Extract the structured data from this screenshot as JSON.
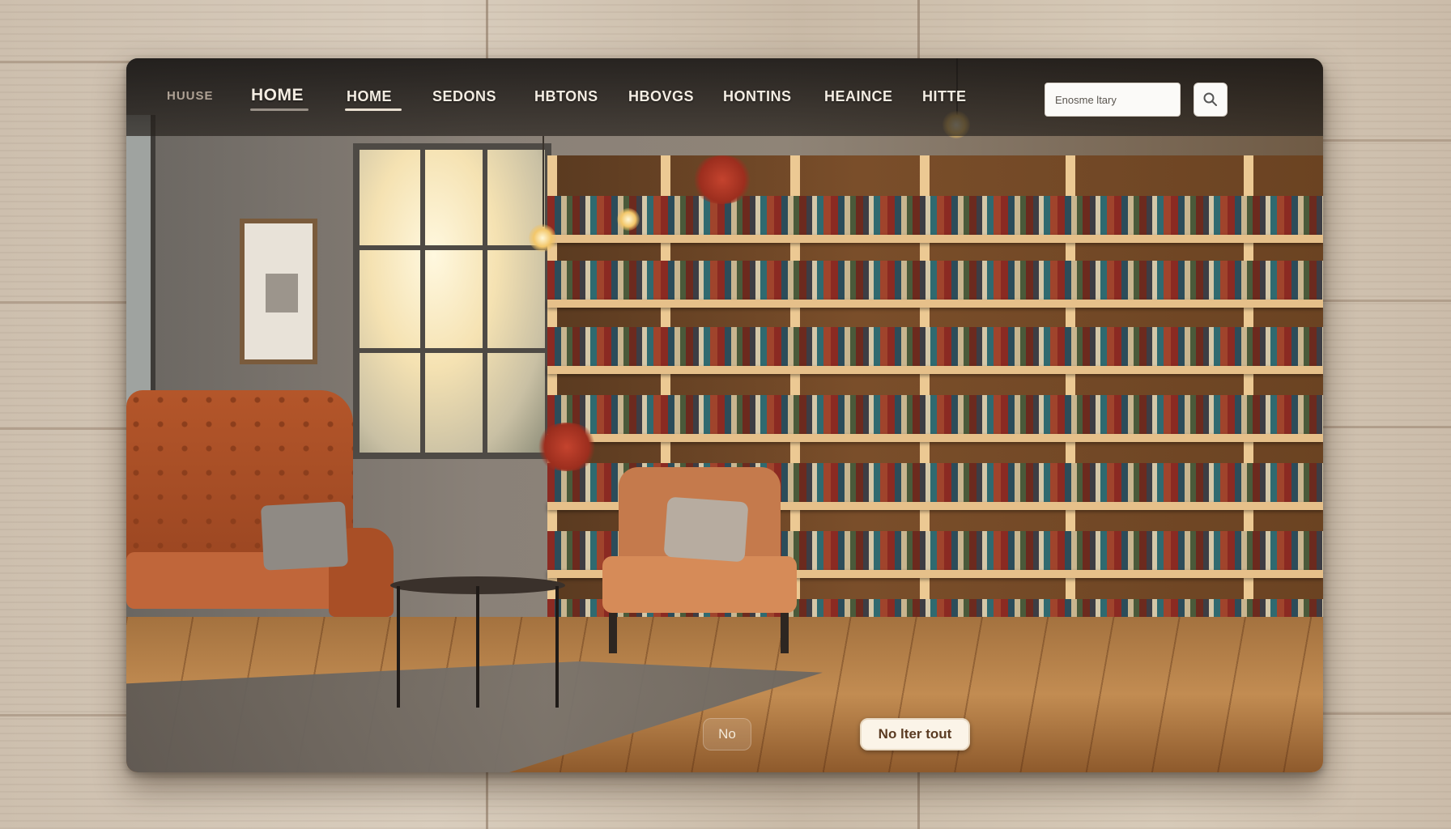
{
  "nav": {
    "brand": "HUUSE",
    "items": [
      {
        "label": "HOME",
        "active": false
      },
      {
        "label": "HOME",
        "active": true
      },
      {
        "label": "SEDONS",
        "active": false
      },
      {
        "label": "HBTONS",
        "active": false
      },
      {
        "label": "HBOVGS",
        "active": false
      },
      {
        "label": "HONTINS",
        "active": false
      },
      {
        "label": "HEAINCE",
        "active": false
      },
      {
        "label": "HITTE",
        "active": false
      }
    ]
  },
  "search": {
    "placeholder": "Enosme ltary",
    "button_icon": "search-icon"
  },
  "buttons": {
    "secondary": "No",
    "primary": "No lter tout"
  },
  "colors": {
    "nav_background": "#1f1b18",
    "nav_text": "#f3ece2",
    "primary_button_bg": "#fbf4e8",
    "primary_button_text": "#5a3b22"
  }
}
